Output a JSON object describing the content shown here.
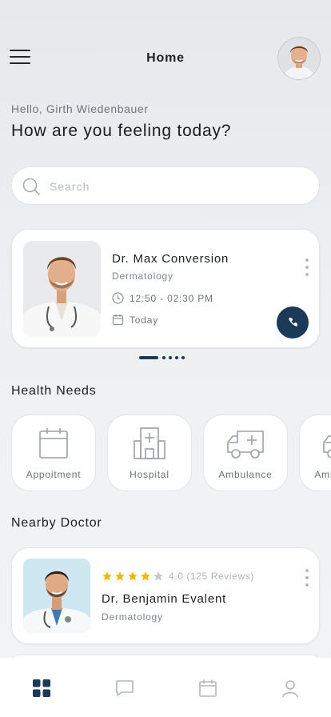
{
  "header": {
    "title": "Home"
  },
  "greeting": "Hello, Girth Wiedenbauer",
  "headline": "How are you feeling today?",
  "search": {
    "placeholder": "Search"
  },
  "appointment": {
    "doctor_name": "Dr. Max Conversion",
    "specialty": "Dermatology",
    "time": "12:50 - 02:30 PM",
    "date": "Today"
  },
  "carousel": {
    "pages": 5,
    "active_index": 0
  },
  "health_needs": {
    "title": "Health Needs",
    "items": [
      {
        "label": "Appoitment",
        "icon": "calendar-icon"
      },
      {
        "label": "Hospital",
        "icon": "hospital-icon"
      },
      {
        "label": "Ambulance",
        "icon": "ambulance-icon"
      },
      {
        "label": "Ambulance",
        "icon": "ambulance-icon"
      }
    ]
  },
  "nearby": {
    "title": "Nearby Doctor",
    "doctor": {
      "rating": 4.0,
      "rating_text": "4.0 (125 Reviews)",
      "name": "Dr. Benjamin Evalent",
      "specialty": "Dermatology"
    }
  },
  "tabbar": {
    "items": [
      {
        "name": "home",
        "icon": "grid-icon",
        "active": true
      },
      {
        "name": "messages",
        "icon": "chat-icon",
        "active": false
      },
      {
        "name": "schedule",
        "icon": "calendar-icon",
        "active": false
      },
      {
        "name": "profile",
        "icon": "user-icon",
        "active": false
      }
    ]
  },
  "colors": {
    "primary": "#1b3a57",
    "star": "#f2b600",
    "star_empty": "#c4c7cb",
    "muted_text": "#7f858b"
  }
}
